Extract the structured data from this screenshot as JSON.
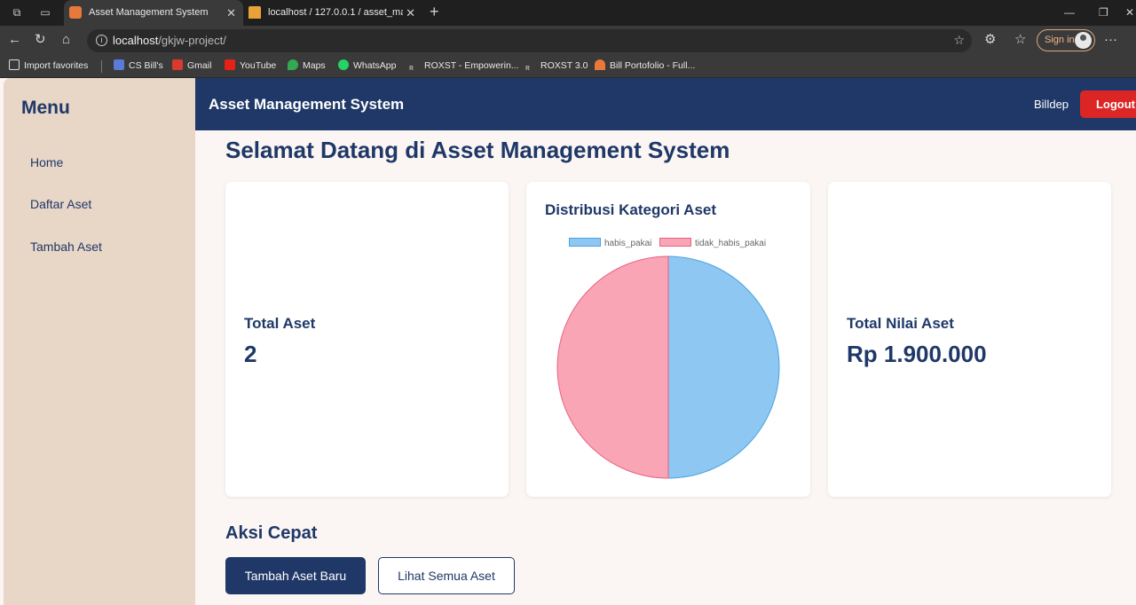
{
  "browser": {
    "tabs": [
      {
        "title": "Asset Management System"
      },
      {
        "title": "localhost / 127.0.0.1 / asset_mana"
      }
    ],
    "url_host": "localhost",
    "url_path": "/gkjw-project/",
    "signin_label": "Sign in",
    "bookmarks": [
      {
        "label": "Import favorites"
      },
      {
        "label": "CS Bill's"
      },
      {
        "label": "Gmail"
      },
      {
        "label": "YouTube"
      },
      {
        "label": "Maps"
      },
      {
        "label": "WhatsApp"
      },
      {
        "label": "ROXST - Empowerin..."
      },
      {
        "label": "ROXST 3.0"
      },
      {
        "label": "Bill Portofolio - Full..."
      }
    ]
  },
  "sidebar": {
    "title": "Menu",
    "items": [
      {
        "label": "Home"
      },
      {
        "label": "Daftar Aset"
      },
      {
        "label": "Tambah Aset"
      }
    ]
  },
  "header": {
    "brand": "Asset Management System",
    "user": "Billdep",
    "logout_label": "Logout"
  },
  "main": {
    "welcome": "Selamat Datang di Asset Management System",
    "total_assets": {
      "label": "Total Aset",
      "value": "2"
    },
    "total_value": {
      "label": "Total Nilai Aset",
      "value": "Rp 1.900.000"
    },
    "quick_actions": {
      "title": "Aksi Cepat",
      "add_label": "Tambah Aset Baru",
      "view_label": "Lihat Semua Aset"
    }
  },
  "chart_data": {
    "type": "pie",
    "title": "Distribusi Kategori Aset",
    "categories": [
      "habis_pakai",
      "tidak_habis_pakai"
    ],
    "values": [
      1,
      1
    ],
    "colors": [
      "#8ec7f1",
      "#f9a5b6"
    ],
    "border_colors": [
      "#4aa3df",
      "#e8637f"
    ],
    "legend": "top"
  }
}
